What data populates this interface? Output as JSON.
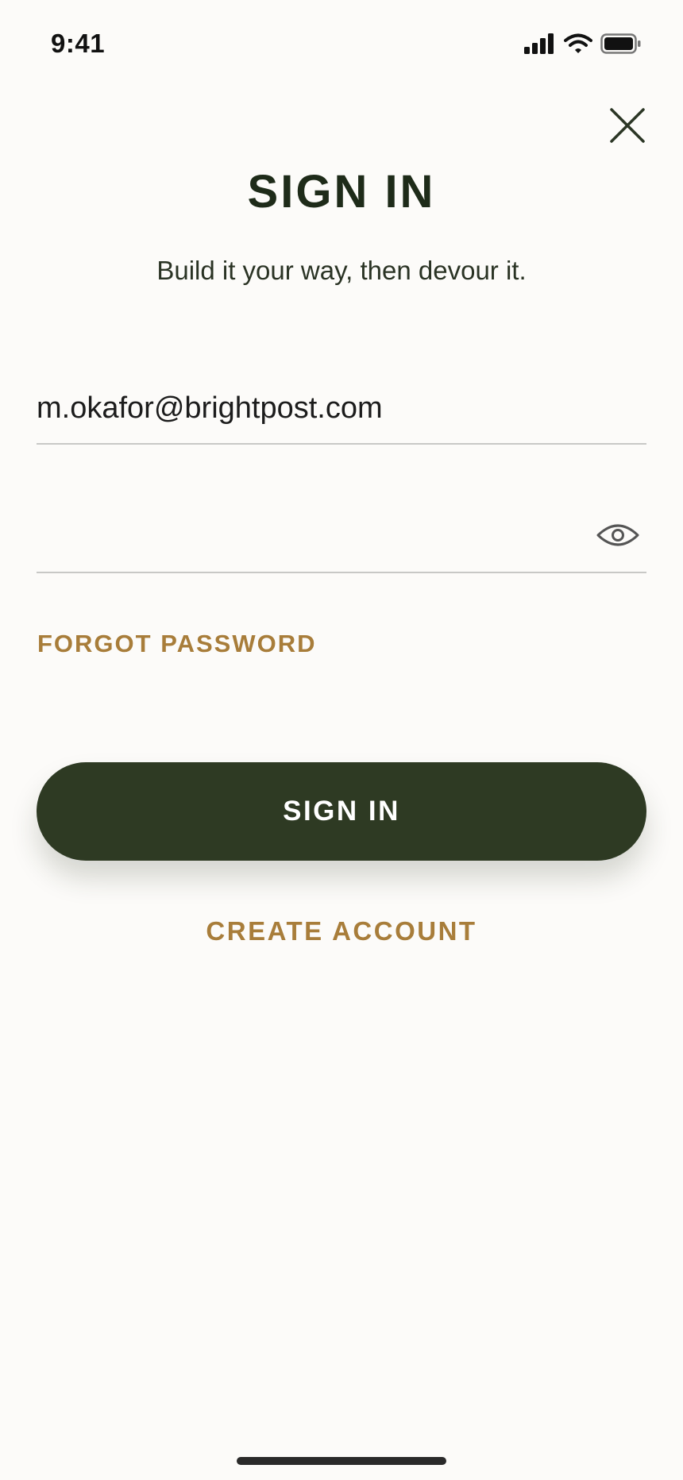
{
  "status_bar": {
    "time": "9:41",
    "icons": [
      "signal-icon",
      "wifi-icon",
      "battery-icon"
    ]
  },
  "header": {
    "close_icon": "close-icon",
    "title": "SIGN IN",
    "subtitle": "Build it your way, then devour it."
  },
  "form": {
    "email_value": "m.okafor@brightpost.com",
    "password_value": "",
    "password_toggle_icon": "eye-icon",
    "forgot_password_label": "FORGOT PASSWORD"
  },
  "actions": {
    "sign_in_label": "SIGN IN",
    "create_account_label": "CREATE ACCOUNT"
  },
  "colors": {
    "background": "#fcfbf9",
    "primary": "#2e3a23",
    "accent": "#a87d3a",
    "title": "#1e2b19"
  }
}
